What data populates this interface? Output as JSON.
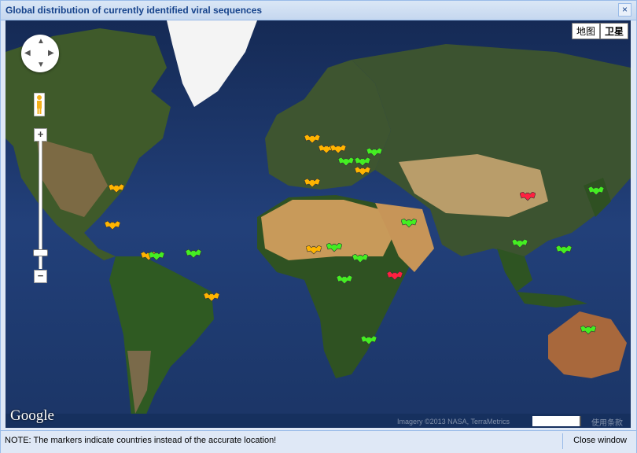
{
  "window": {
    "title": "Global distribution of currently identified viral sequences",
    "close_glyph": "×"
  },
  "map": {
    "map_types": [
      "地图",
      "卫星"
    ],
    "active_map_type": "卫星",
    "zoom_in_label": "+",
    "zoom_out_label": "−",
    "google_logo": "Google",
    "attribution": "Imagery ©2013 NASA, TerraMetrics",
    "terms": "使用条款",
    "icons": [
      "pan-control-icon",
      "pegman-icon",
      "bat-marker-icon"
    ],
    "marker_colors": {
      "orange": "#ffb400",
      "green": "#44ee22",
      "red": "#ff2040"
    },
    "ocean_color": "#1e3563"
  },
  "markers": [
    {
      "color": "orange",
      "lon": -100,
      "lat": 38
    },
    {
      "color": "orange",
      "lon": -102,
      "lat": 23
    },
    {
      "color": "orange",
      "lon": -84,
      "lat": 9
    },
    {
      "color": "green",
      "lon": -80,
      "lat": 9
    },
    {
      "color": "green",
      "lon": -62,
      "lat": 10
    },
    {
      "color": "orange",
      "lon": -53,
      "lat": -10
    },
    {
      "color": "orange",
      "lon": -3,
      "lat": 54
    },
    {
      "color": "orange",
      "lon": 4,
      "lat": 51
    },
    {
      "color": "orange",
      "lon": 10,
      "lat": 51
    },
    {
      "color": "orange",
      "lon": -3,
      "lat": 40
    },
    {
      "color": "green",
      "lon": 14,
      "lat": 47
    },
    {
      "color": "green",
      "lon": 22,
      "lat": 47
    },
    {
      "color": "green",
      "lon": 28,
      "lat": 50
    },
    {
      "color": "orange",
      "lon": 22,
      "lat": 44
    },
    {
      "color": "orange",
      "lon": -2,
      "lat": 12
    },
    {
      "color": "green",
      "lon": 8,
      "lat": 13
    },
    {
      "color": "green",
      "lon": 21,
      "lat": 8
    },
    {
      "color": "green",
      "lon": 13,
      "lat": -2
    },
    {
      "color": "red",
      "lon": 38,
      "lat": 0
    },
    {
      "color": "green",
      "lon": 25,
      "lat": -29
    },
    {
      "color": "green",
      "lon": 45,
      "lat": 24
    },
    {
      "color": "red",
      "lon": 104,
      "lat": 35
    },
    {
      "color": "green",
      "lon": 100,
      "lat": 15
    },
    {
      "color": "green",
      "lon": 122,
      "lat": 12
    },
    {
      "color": "green",
      "lon": 138,
      "lat": 37
    },
    {
      "color": "green",
      "lon": 134,
      "lat": -25
    }
  ],
  "footer": {
    "note": "NOTE: The markers indicate countries instead of the accurate location!",
    "close_window": "Close window"
  }
}
